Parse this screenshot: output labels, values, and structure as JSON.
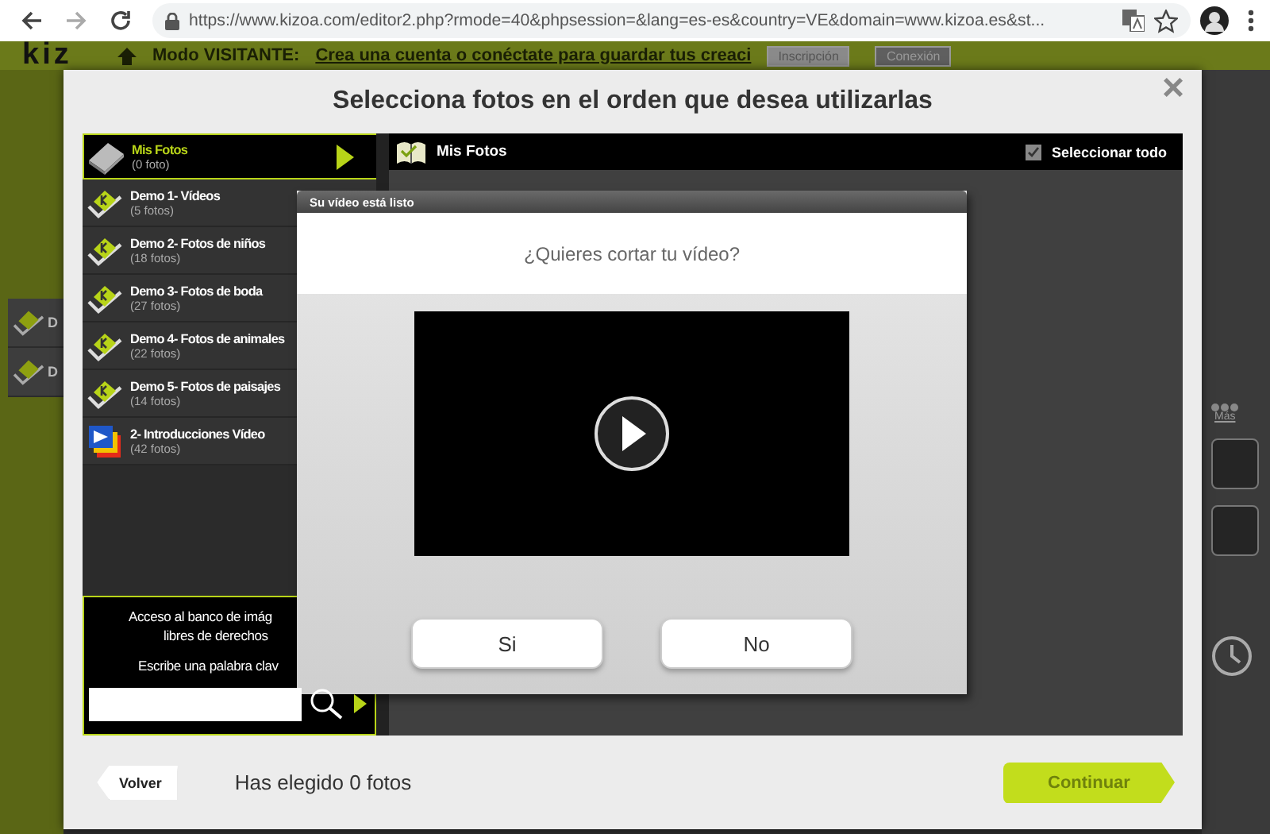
{
  "browser": {
    "url": "https://www.kizoa.com/editor2.php?rmode=40&phpsession=&lang=es-es&country=VE&domain=www.kizoa.es&st..."
  },
  "app": {
    "logo": "kiz",
    "notice_bold": "Modo VISITANTE:",
    "notice": "Crea una cuenta o conéctate para guardar tus creaci",
    "buttons": [
      "Inscripción",
      "Conexión"
    ],
    "more": "Más",
    "side_items": [
      "D",
      "D"
    ]
  },
  "modal": {
    "title": "Selecciona fotos en el orden que desea utilizarlas",
    "close": "×",
    "albums": [
      {
        "title": "Mis Fotos",
        "count": "(0 foto)",
        "kind": "user",
        "selected": true
      },
      {
        "title": "Demo 1- Vídeos",
        "count": "(5 fotos)",
        "kind": "demo",
        "selected": false
      },
      {
        "title": "Demo 2- Fotos de niños",
        "count": "(18 fotos)",
        "kind": "demo",
        "selected": false
      },
      {
        "title": "Demo 3- Fotos de boda",
        "count": "(27 fotos)",
        "kind": "demo",
        "selected": false
      },
      {
        "title": "Demo 4- Fotos de animales",
        "count": "(22 fotos)",
        "kind": "demo",
        "selected": false
      },
      {
        "title": "Demo 5- Fotos de paisajes",
        "count": "(14 fotos)",
        "kind": "demo",
        "selected": false
      },
      {
        "title": "2- Introducciones Vídeo",
        "count": "(42 fotos)",
        "kind": "intro",
        "selected": false
      }
    ],
    "image_bank": {
      "lines": [
        "Acceso al banco de imág",
        "libres de derechos"
      ],
      "prompt": "Escribe una palabra clav"
    },
    "panel": {
      "title": "Mis Fotos",
      "select_all": {
        "label": "Seleccionar todo",
        "checked": true
      }
    },
    "footer": {
      "back": "Volver",
      "status": "Has elegido 0 fotos",
      "continue": {
        "label": "Continuar",
        "disabled": true
      }
    }
  },
  "video_dialog": {
    "title": "Su vídeo está listo",
    "question": "¿Quieres cortar tu vídeo?",
    "buttons": [
      "Si",
      "No"
    ]
  }
}
